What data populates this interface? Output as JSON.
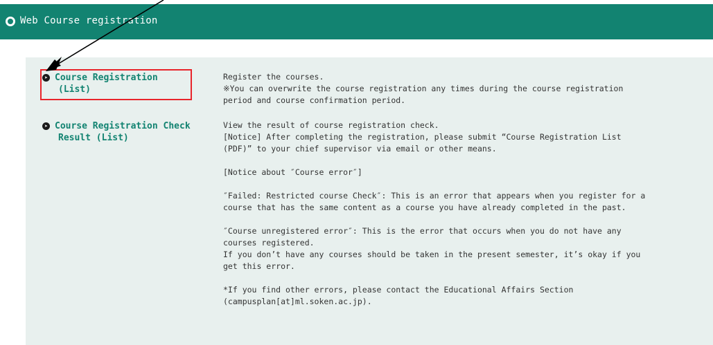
{
  "header": {
    "title": "Web Course registration"
  },
  "nav": {
    "item1": {
      "line1": "Course Registration",
      "line2": "(List)"
    },
    "item2": {
      "line1": "Course Registration Check",
      "line2": "Result (List)"
    }
  },
  "desc1": {
    "l1": "Register the courses.",
    "l2": "※You can overwrite the course registration any times during the course registration",
    "l3": "period and course confirmation period."
  },
  "desc2": {
    "l1": "View the result of course registration check.",
    "l2": "[Notice] After completing the registration, please submit “Course Registration List",
    "l3": "(PDF)” to your chief supervisor via email or other means.",
    "l4": "[Notice about ″Course error″]",
    "l5": "″Failed: Restricted course Check″: This is an error that appears when you register for a",
    "l6": "course that has the same content as a course you have already completed in the past.",
    "l7": "″Course unregistered error″: This is the error that occurs when you do not have any",
    "l8": "courses registered.",
    "l9": "If you don’t have any courses should be taken in the present semester, it’s okay if you",
    "l10": "get this error.",
    "l11": "*If you find other errors, please contact the Educational Affairs Section",
    "l12": "(campusplan[at]ml.soken.ac.jp)."
  },
  "colors": {
    "header_bg": "#128371",
    "link": "#128371",
    "panel_bg": "#e8f0ee",
    "highlight": "#e8242a"
  }
}
